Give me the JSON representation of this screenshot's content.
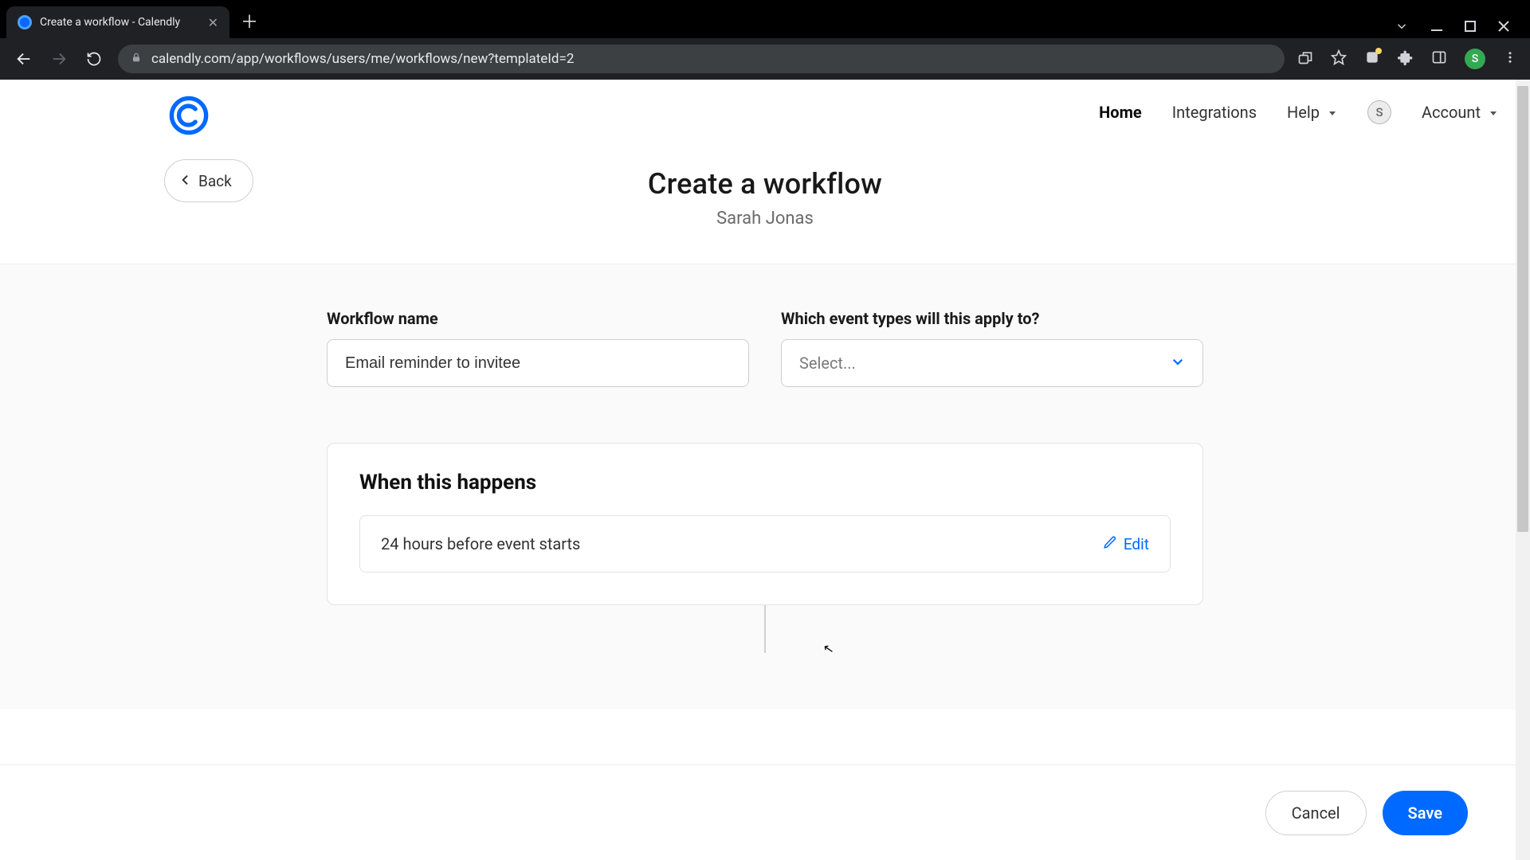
{
  "browser": {
    "tab_title": "Create a workflow - Calendly",
    "url": "calendly.com/app/workflows/users/me/workflows/new?templateId=2",
    "profile_initial": "S"
  },
  "nav": {
    "home": "Home",
    "integrations": "Integrations",
    "help": "Help",
    "account": "Account",
    "avatar_initial": "S"
  },
  "header": {
    "back": "Back",
    "title": "Create a workflow",
    "subtitle": "Sarah Jonas"
  },
  "form": {
    "name_label": "Workflow name",
    "name_value": "Email reminder to invitee",
    "event_types_label": "Which event types will this apply to?",
    "event_types_placeholder": "Select..."
  },
  "trigger": {
    "heading": "When this happens",
    "condition": "24 hours before event starts",
    "edit": "Edit"
  },
  "footer": {
    "cancel": "Cancel",
    "save": "Save"
  }
}
